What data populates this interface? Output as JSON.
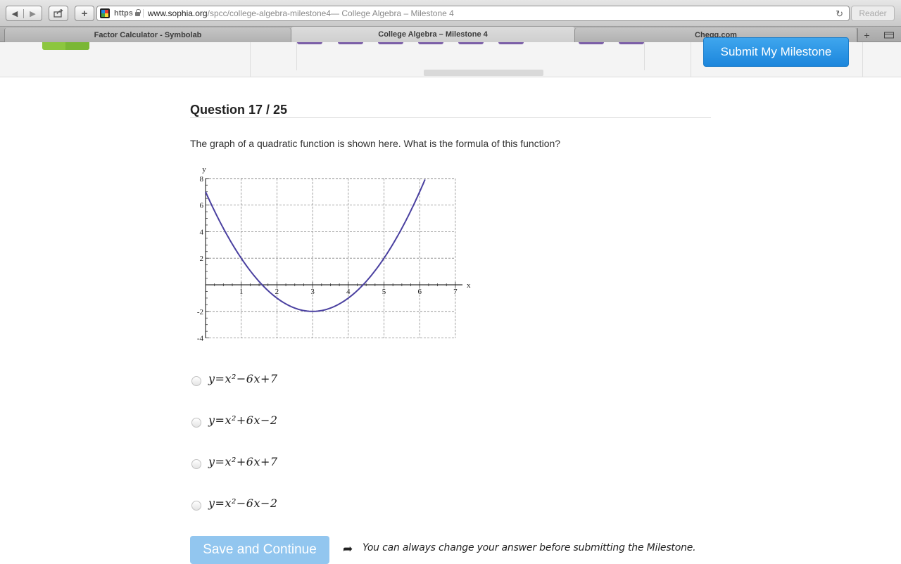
{
  "browser": {
    "address": {
      "scheme": "https",
      "host": "www.sophia.org",
      "path": "/spcc/college-algebra-milestone4",
      "title_suffix": " — College Algebra – Milestone 4"
    },
    "reader_label": "Reader",
    "tabs": [
      {
        "label": "Factor Calculator - Symbolab"
      },
      {
        "label": "College Algebra – Milestone 4"
      },
      {
        "label": "Chegg.com"
      }
    ],
    "icons": {
      "back": "triangle-left-icon",
      "forward": "triangle-right-icon",
      "share": "share-icon",
      "new_tab": "plus-icon",
      "reload": "reload-icon",
      "tab_overview": "tab-overview-icon"
    }
  },
  "header": {
    "submit_label": "Submit My Milestone"
  },
  "question": {
    "title": "Question 17 / 25",
    "prompt": "The graph of a quadratic function is shown here. What is the formula of this function?",
    "options": [
      {
        "formula": "y=x²−6x+7"
      },
      {
        "formula": "y=x²+6x−2"
      },
      {
        "formula": "y=x²+6x+7"
      },
      {
        "formula": "y=x²−6x−2"
      }
    ]
  },
  "graph": {
    "x_axis_label": "x",
    "y_axis_label": "y",
    "x_ticks": [
      "1",
      "2",
      "3",
      "4",
      "5",
      "6",
      "7"
    ],
    "y_ticks": [
      "8",
      "6",
      "4",
      "2",
      "-2",
      "-4"
    ],
    "curve_color": "#4a40a0",
    "function": {
      "a": 1,
      "b": -6,
      "c": 7
    }
  },
  "footer": {
    "save_label": "Save and Continue",
    "hint": "You can always change your answer before submitting the Milestone."
  }
}
